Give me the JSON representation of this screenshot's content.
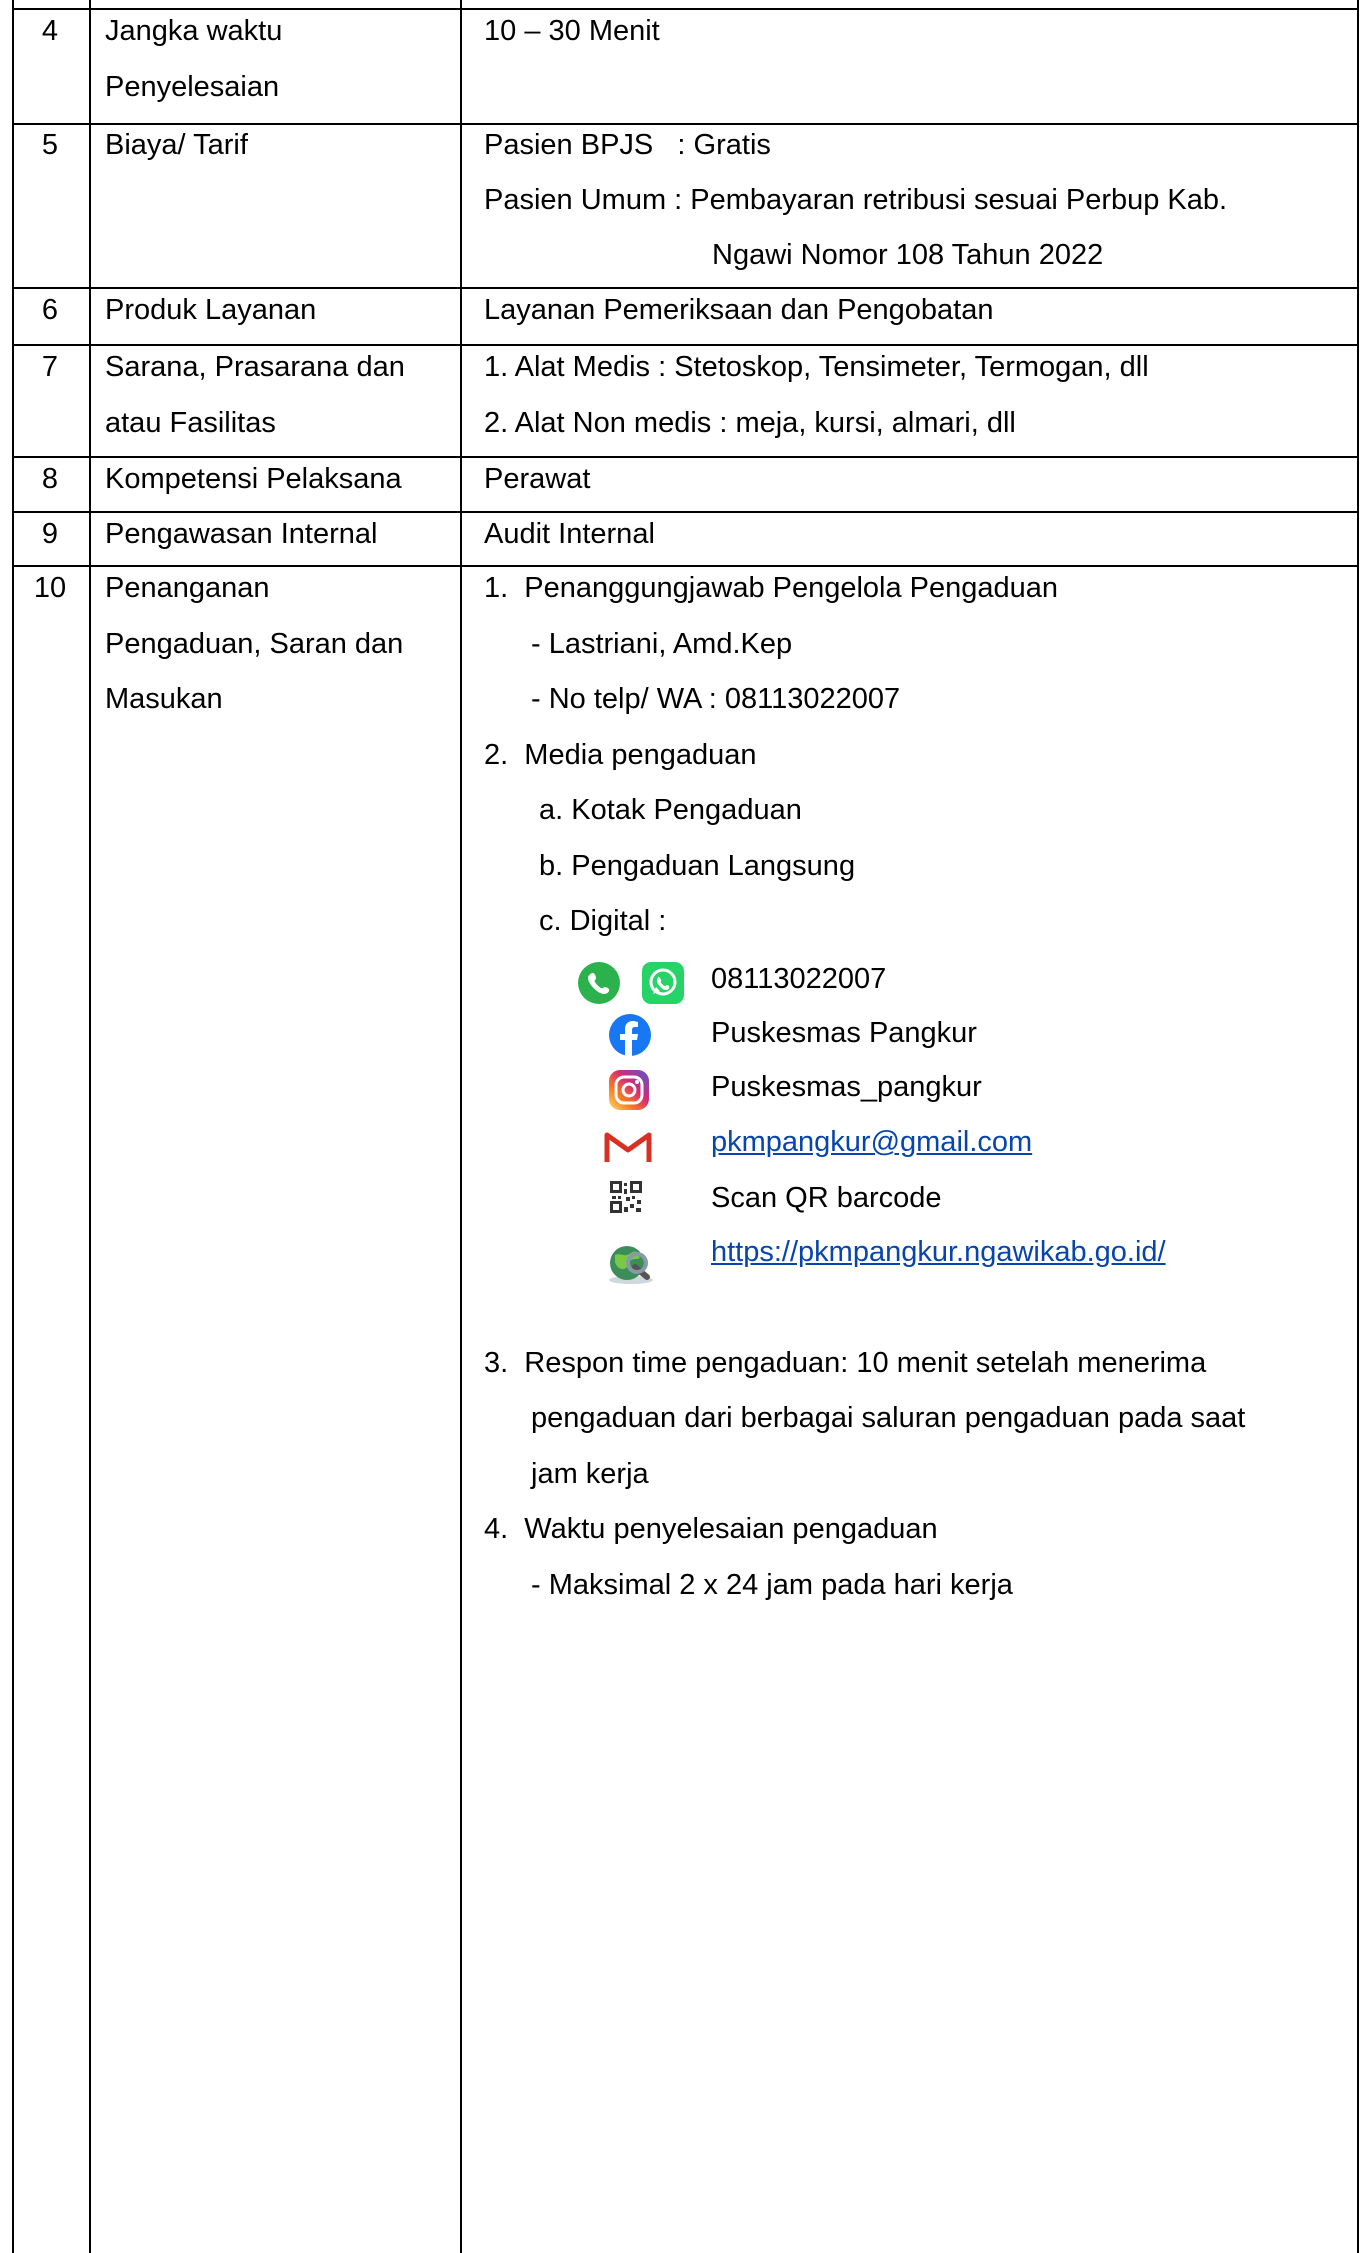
{
  "rows": [
    {
      "no": "4",
      "label_lines": [
        "Jangka waktu",
        "Penyelesaian"
      ],
      "content": {
        "text": "10 – 30 Menit"
      }
    },
    {
      "no": "5",
      "label_lines": [
        "Biaya/ Tarif"
      ],
      "content": {
        "bpjs": "Pasien BPJS   : Gratis",
        "umum_line1": "Pasien Umum : Pembayaran retribusi sesuai Perbup Kab.",
        "umum_line2": "Ngawi Nomor 108 Tahun 2022"
      }
    },
    {
      "no": "6",
      "label_lines": [
        "Produk Layanan"
      ],
      "content": {
        "text": "Layanan Pemeriksaan dan Pengobatan"
      }
    },
    {
      "no": "7",
      "label_lines": [
        "Sarana, Prasarana dan",
        "atau Fasilitas"
      ],
      "content": {
        "item1": "1. Alat Medis : Stetoskop, Tensimeter, Termogan, dll",
        "item2": "2. Alat Non medis : meja, kursi, almari, dll"
      }
    },
    {
      "no": "8",
      "label_lines": [
        "Kompetensi Pelaksana"
      ],
      "content": {
        "text": "Perawat"
      }
    },
    {
      "no": "9",
      "label_lines": [
        "Pengawasan Internal"
      ],
      "content": {
        "text": "Audit Internal"
      }
    },
    {
      "no": "10",
      "label_lines": [
        "Penanganan",
        "Pengaduan, Saran dan",
        "Masukan"
      ],
      "content": {
        "p1": "1.  Penanggungjawab Pengelola Pengaduan",
        "p1_a": "- Lastriani, Amd.Kep",
        "p1_b": "- No telp/ WA : 08113022007",
        "p2": "2.  Media pengaduan",
        "p2_a": "a. Kotak Pengaduan",
        "p2_b": "b. Pengaduan Langsung",
        "p2_c": "c. Digital :",
        "digital": {
          "phone": "08113022007",
          "facebook": "Puskesmas Pangkur",
          "instagram": "Puskesmas_pangkur",
          "email": "pkmpangkur@gmail.com",
          "qr": "Scan QR barcode",
          "web": "https://pkmpangkur.ngawikab.go.id/"
        },
        "p3_l1": "3.  Respon time pengaduan: 10 menit setelah menerima",
        "p3_l2": "pengaduan dari berbagai saluran pengaduan pada saat",
        "p3_l3": "jam kerja",
        "p4": "4.  Waktu penyelesaian pengaduan",
        "p4_a": "- Maksimal 2 x 24 jam pada hari kerja"
      }
    }
  ],
  "icons": {
    "phone": "phone-icon",
    "whatsapp": "whatsapp-icon",
    "facebook": "facebook-icon",
    "instagram": "instagram-icon",
    "gmail": "gmail-icon",
    "qr": "qr-code-icon",
    "web": "globe-icon"
  },
  "colors": {
    "phone_green": "#2bb24c",
    "whatsapp_green": "#25d366",
    "facebook_blue": "#1877f2",
    "instagram_pink": "#e1306c",
    "gmail_red": "#d93025",
    "link": "#0645ad"
  }
}
